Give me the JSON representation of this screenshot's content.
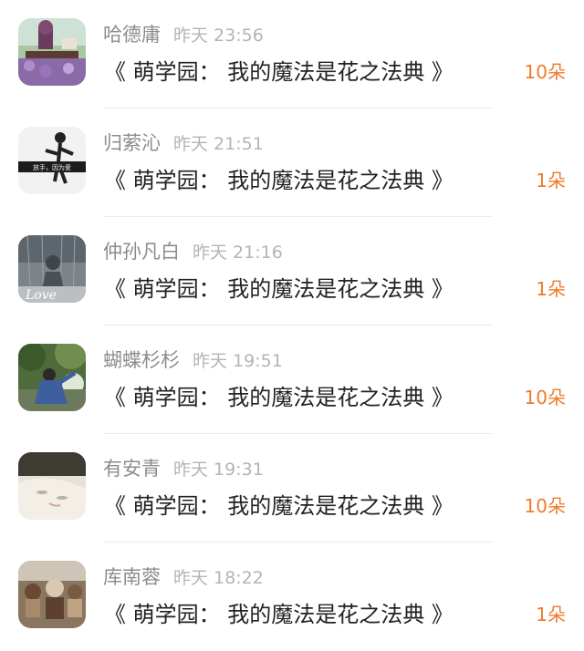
{
  "rows": [
    {
      "username": "哈德庸",
      "time": "昨天 23:56",
      "title": "《 萌学园： 我的魔法是花之法典 》",
      "amount": "10朵",
      "avatar": "lavender-field-avatar"
    },
    {
      "username": "归萦沁",
      "time": "昨天 21:51",
      "title": "《 萌学园： 我的魔法是花之法典 》",
      "amount": "1朵",
      "avatar": "dancer-avatar",
      "avatar_caption": "放手，因为爱"
    },
    {
      "username": "仲孙凡白",
      "time": "昨天 21:16",
      "title": "《 萌学园： 我的魔法是花之法典 》",
      "amount": "1朵",
      "avatar": "glass-rain-avatar",
      "avatar_caption": "Love"
    },
    {
      "username": "蝴蝶杉杉",
      "time": "昨天 19:51",
      "title": "《 萌学园： 我的魔法是花之法典 》",
      "amount": "10朵",
      "avatar": "girl-under-trees-avatar"
    },
    {
      "username": "有安青",
      "time": "昨天 19:31",
      "title": "《 萌学园： 我的魔法是花之法典 》",
      "amount": "10朵",
      "avatar": "pale-face-avatar"
    },
    {
      "username": "库南蓉",
      "time": "昨天 18:22",
      "title": "《 萌学园： 我的魔法是花之法典 》",
      "amount": "1朵",
      "avatar": "toy-figures-avatar"
    }
  ],
  "colors": {
    "amount": "#f07a2a",
    "username": "#8c8c8c",
    "time": "#b4b4b4",
    "title": "#222222"
  }
}
